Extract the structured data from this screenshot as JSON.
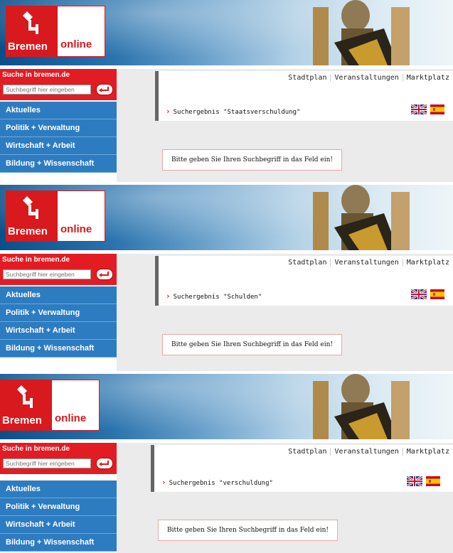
{
  "logo": {
    "word_red": "Bremen",
    "word_white": "online",
    "brand_red": "#d8191e"
  },
  "search": {
    "title": "Suche in bremen.de",
    "placeholder": "Suchbegriff hier eingeben",
    "button_icon": "return-arrow-icon"
  },
  "nav_items": [
    "Aktuelles",
    "Politik + Verwaltung",
    "Wirtschaft + Arbeit",
    "Bildung + Wissenschaft"
  ],
  "top_links": [
    "Stadtplan",
    "Veranstaltungen",
    "Marktplatz"
  ],
  "flags": [
    "uk-flag-icon",
    "spain-flag-icon"
  ],
  "panels": [
    {
      "result": "Suchergebnis \"Staatsverschuldung\"",
      "message": "Bitte geben Sie Ihren Suchbegriff in das Feld ein!"
    },
    {
      "result": "Suchergebnis \"Schulden\"",
      "message": "Bitte geben Sie Ihren Suchbegriff in das Feld ein!"
    },
    {
      "result": "Suchergebnis \"verschuldung\"",
      "message": "Bitte geben Sie Ihren Suchbegriff in das Feld ein!"
    }
  ],
  "colors": {
    "nav_blue": "#2d7cc1",
    "search_red": "#e31c23",
    "content_gray": "#ebebeb"
  }
}
